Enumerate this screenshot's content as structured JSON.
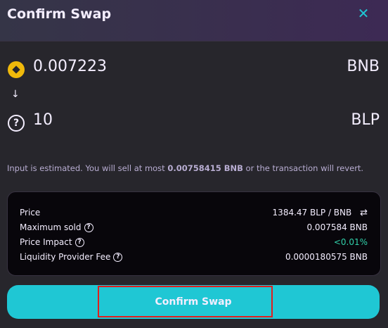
{
  "header": {
    "title": "Confirm Swap",
    "close_icon": "close-icon"
  },
  "input": {
    "amount": "0.007223",
    "symbol": "BNB",
    "icon": "bnb-token-icon"
  },
  "arrow": "↓",
  "output": {
    "amount": "10",
    "symbol": "BLP",
    "icon": "unknown-token-icon"
  },
  "note": {
    "prefix": "Input is estimated. You will sell at most ",
    "max_amount": "0.00758415 BNB",
    "suffix": " or the transaction will revert."
  },
  "details": {
    "price_label": "Price",
    "price_value": "1384.47 BLP / BNB",
    "max_sold_label": "Maximum sold",
    "max_sold_value": "0.007584 BNB",
    "impact_label": "Price Impact",
    "impact_value": "<0.01%",
    "fee_label": "Liquidity Provider Fee",
    "fee_value": "0.0000180575 BNB"
  },
  "confirm_button": {
    "label": "Confirm Swap"
  },
  "colors": {
    "accent": "#1fc7d4",
    "success": "#31d0aa",
    "highlight": "#e01e1e"
  }
}
